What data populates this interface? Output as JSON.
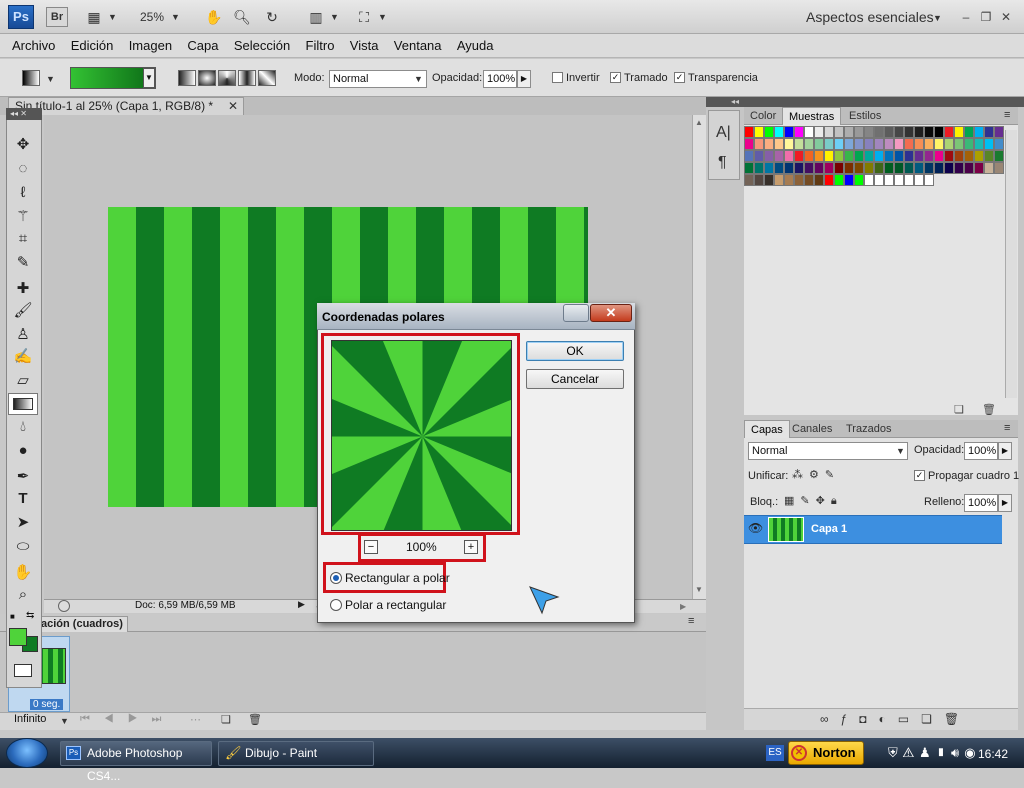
{
  "appbar": {
    "ps_logo": "Ps",
    "br_logo": "Br",
    "zoom": "25%",
    "workspace": "Aspectos esenciales"
  },
  "menu": [
    "Archivo",
    "Edición",
    "Imagen",
    "Capa",
    "Selección",
    "Filtro",
    "Vista",
    "Ventana",
    "Ayuda"
  ],
  "options": {
    "modo_label": "Modo:",
    "modo_value": "Normal",
    "opacidad_label": "Opacidad:",
    "opacidad_value": "100%",
    "invertir": "Invertir",
    "tramado": "Tramado",
    "transparencia": "Transparencia",
    "gradient_start": "#33c233",
    "gradient_end": "#0b6a16"
  },
  "document": {
    "tab_title": "Sin título-1 al 25% (Capa 1, RGB/8) *",
    "status": "Doc: 6,59 MB/6,59 MB",
    "stripe_light": "#4fd33a",
    "stripe_dark": "#0f7b23"
  },
  "animation": {
    "title": "ación (cuadros)",
    "frame_number": "1",
    "frame_delay": "0 seg.",
    "loop": "Infinito"
  },
  "swatch_tabs": [
    "Color",
    "Muestras",
    "Estilos"
  ],
  "layers": {
    "tabs": [
      "Capas",
      "Canales",
      "Trazados"
    ],
    "blend_mode": "Normal",
    "opacidad_label": "Opacidad:",
    "opacidad_value": "100%",
    "unificar_label": "Unificar:",
    "propagar_label": "Propagar cuadro 1",
    "bloq_label": "Bloq.:",
    "relleno_label": "Relleno:",
    "relleno_value": "100%",
    "layer_name": "Capa 1"
  },
  "dialog": {
    "title": "Coordenadas polares",
    "close": "✕",
    "ok": "OK",
    "cancel": "Cancelar",
    "zoom": "100%",
    "zoom_minus": "−",
    "zoom_plus": "+",
    "option1": "Rectangular a polar",
    "option2": "Polar a rectangular",
    "selected_option": "Rectangular a polar"
  },
  "taskbar": {
    "task1": "Adobe Photoshop CS4...",
    "task2": "Dibujo - Paint",
    "lang": "ES",
    "norton": "Norton",
    "time": "16:42"
  }
}
